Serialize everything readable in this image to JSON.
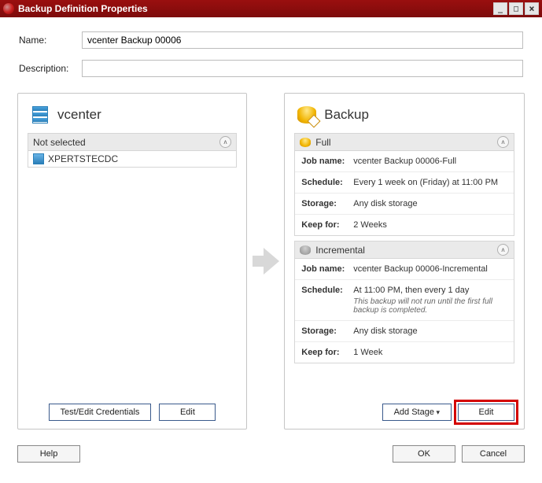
{
  "window": {
    "title": "Backup Definition Properties",
    "min_symbol": "_",
    "max_symbol": "□",
    "close_symbol": "×"
  },
  "form": {
    "name_label": "Name:",
    "name_value": "vcenter Backup 00006",
    "desc_label": "Description:",
    "desc_value": ""
  },
  "left_panel": {
    "title": "vcenter",
    "section_header": "Not selected",
    "items": [
      {
        "label": "XPERTSTECDC"
      }
    ],
    "test_credentials_label": "Test/Edit Credentials",
    "edit_label": "Edit"
  },
  "right_panel": {
    "title": "Backup",
    "groups": [
      {
        "type": "full",
        "header": "Full",
        "rows": [
          {
            "k": "Job name:",
            "v": "vcenter Backup 00006-Full"
          },
          {
            "k": "Schedule:",
            "v": "Every 1 week on (Friday) at 11:00 PM"
          },
          {
            "k": "Storage:",
            "v": "Any disk storage"
          },
          {
            "k": "Keep for:",
            "v": "2 Weeks"
          }
        ]
      },
      {
        "type": "inc",
        "header": "Incremental",
        "rows": [
          {
            "k": "Job name:",
            "v": "vcenter Backup 00006-Incremental"
          },
          {
            "k": "Schedule:",
            "v": "At 11:00 PM, then every 1 day",
            "note": "This backup will not run until the first full backup is completed."
          },
          {
            "k": "Storage:",
            "v": "Any disk storage"
          },
          {
            "k": "Keep for:",
            "v": "1 Week"
          }
        ]
      }
    ],
    "add_stage_label": "Add Stage",
    "edit_label": "Edit"
  },
  "footer": {
    "help_label": "Help",
    "ok_label": "OK",
    "cancel_label": "Cancel"
  }
}
